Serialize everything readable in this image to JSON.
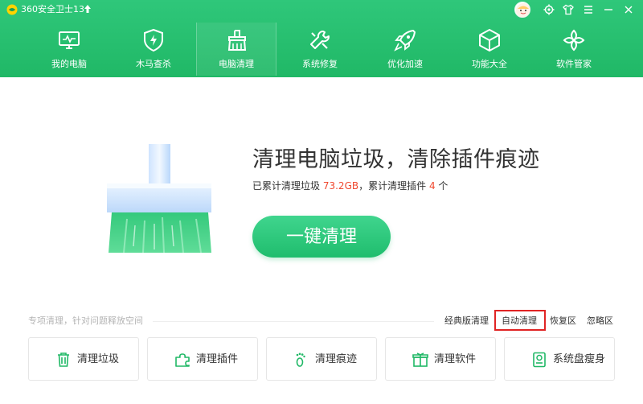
{
  "window": {
    "title": "360安全卫士13"
  },
  "nav": [
    {
      "label": "我的电脑",
      "icon": "monitor-icon"
    },
    {
      "label": "木马查杀",
      "icon": "shield-icon"
    },
    {
      "label": "电脑清理",
      "icon": "broom-icon",
      "active": true
    },
    {
      "label": "系统修复",
      "icon": "wrench-icon"
    },
    {
      "label": "优化加速",
      "icon": "rocket-icon"
    },
    {
      "label": "功能大全",
      "icon": "cube-icon"
    },
    {
      "label": "软件管家",
      "icon": "grid-icon"
    }
  ],
  "hero": {
    "title": "清理电脑垃圾，清除插件痕迹",
    "sub_prefix": "已累计清理垃圾",
    "junk_amount": "73.2GB",
    "sub_mid": "，累计清理插件",
    "plugin_count": "4",
    "sub_suffix": "个",
    "button": "一键清理"
  },
  "bottom": {
    "special_label": "专项清理，针对问题释放空间",
    "links": [
      "经典版清理",
      "自动清理",
      "恢复区",
      "忽略区"
    ]
  },
  "tools": [
    {
      "label": "清理垃圾",
      "icon": "trash-icon"
    },
    {
      "label": "清理插件",
      "icon": "puzzle-icon"
    },
    {
      "label": "清理痕迹",
      "icon": "footprint-icon"
    },
    {
      "label": "清理软件",
      "icon": "package-icon"
    },
    {
      "label": "系统盘瘦身",
      "icon": "disk-icon"
    }
  ],
  "colors": {
    "brand_green": "#20b866",
    "accent_red": "#f0482f",
    "highlight_box": "#e02424"
  }
}
